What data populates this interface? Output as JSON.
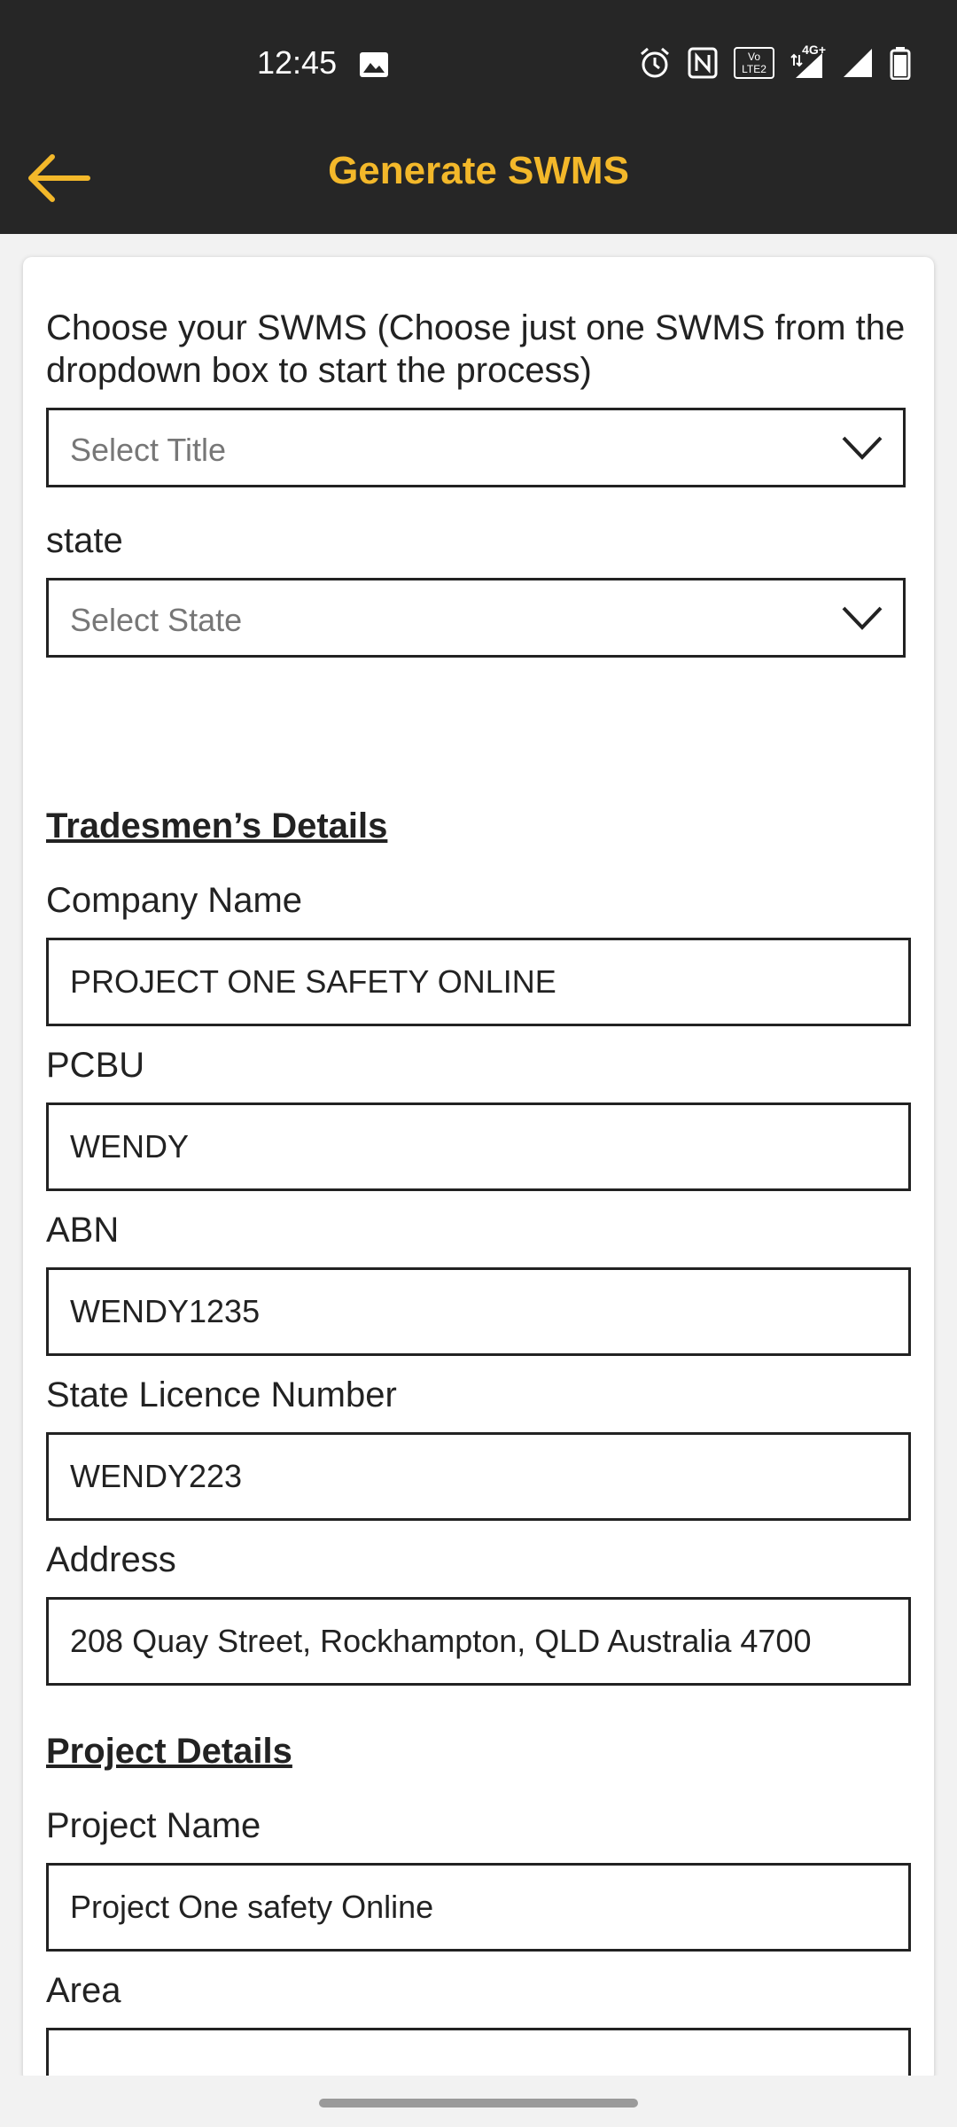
{
  "status_bar": {
    "time": "12:45",
    "icons": [
      "image-icon",
      "alarm-icon",
      "nfc-icon",
      "volte-icon",
      "network-4g-icon",
      "signal-icon",
      "battery-icon"
    ],
    "network_label": "4G+",
    "volte_label": "Vo LTE2"
  },
  "app_bar": {
    "title": "Generate SWMS",
    "back_icon": "arrow-left-icon",
    "accent_color": "#f3b82a",
    "background_color": "#262626"
  },
  "form": {
    "swms_label": "Choose your SWMS (Choose just one SWMS from the dropdown box to start the process)",
    "title_select_placeholder": "Select Title",
    "state_label": "state",
    "state_select_placeholder": "Select State",
    "tradesmen_heading": "Tradesmen’s Details",
    "company_name_label": "Company Name",
    "company_name_value": "PROJECT ONE SAFETY ONLINE",
    "pcbu_label": "PCBU",
    "pcbu_value": "WENDY",
    "abn_label": "ABN",
    "abn_value": "WENDY1235",
    "licence_label": "State Licence Number",
    "licence_value": "WENDY223",
    "address_label": "Address",
    "address_value": "208 Quay Street, Rockhampton, QLD Australia 4700",
    "project_heading": "Project Details",
    "project_name_label": "Project Name",
    "project_name_value": "Project One safety Online",
    "area_label": "Area",
    "area_value": ""
  }
}
